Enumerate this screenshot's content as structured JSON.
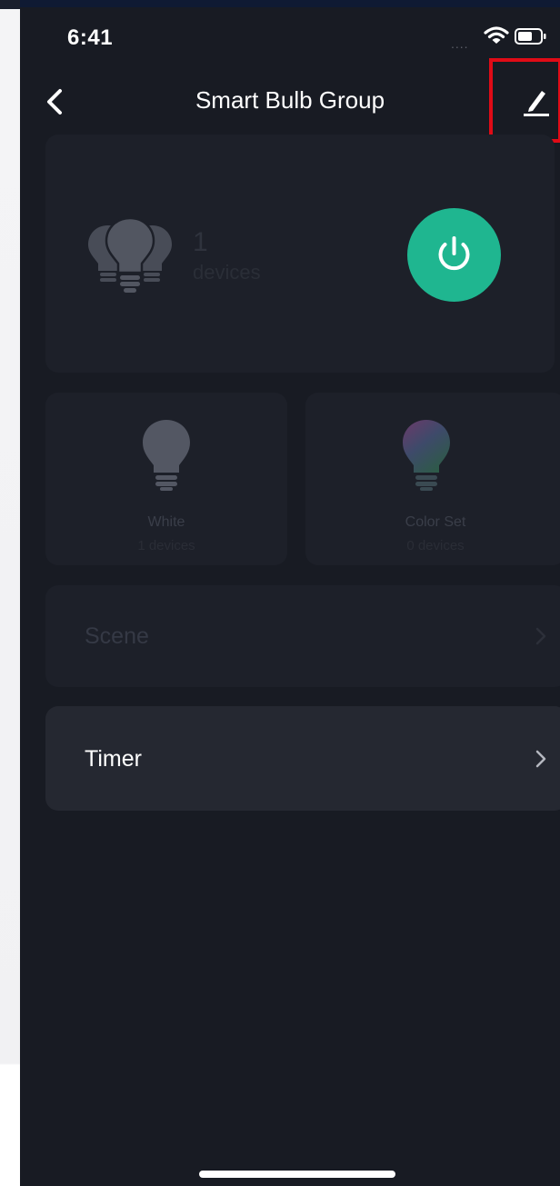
{
  "status_bar": {
    "time": "6:41",
    "signal": "...."
  },
  "nav": {
    "title": "Smart Bulb Group"
  },
  "group": {
    "count": "1",
    "unit": "devices"
  },
  "options": [
    {
      "label": "White",
      "count": "1 devices"
    },
    {
      "label": "Color Set",
      "count": "0 devices"
    }
  ],
  "menu": {
    "scene": "Scene",
    "timer": "Timer"
  },
  "colors": {
    "background": "#181b23",
    "card": "#1d2029",
    "power_accent": "#1fb690",
    "highlight_border": "#e00b16"
  }
}
